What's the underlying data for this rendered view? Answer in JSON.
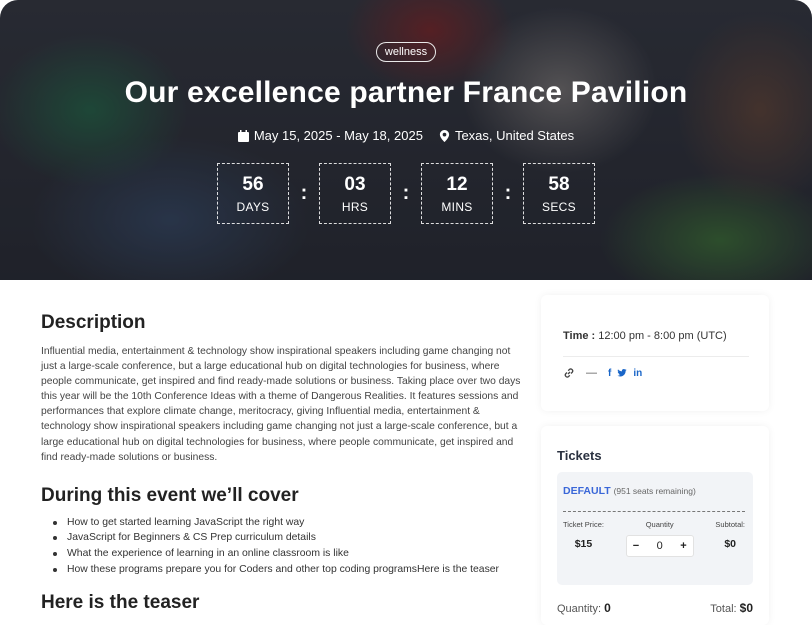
{
  "hero": {
    "tag": "wellness",
    "title": "Our excellence partner France Pavilion",
    "date_range": "May 15, 2025 - May 18, 2025",
    "location": "Texas, United States",
    "countdown": [
      {
        "value": "56",
        "label": "DAYS"
      },
      {
        "value": "03",
        "label": "HRS"
      },
      {
        "value": "12",
        "label": "MINS"
      },
      {
        "value": "58",
        "label": "SECS"
      }
    ],
    "separator": ":"
  },
  "description": {
    "heading": "Description",
    "text": "Influential media, entertainment & technology show inspirational speakers including game changing not just a large-scale conference, but a large educational hub on digital technologies for business, where people communicate, get inspired and find ready-made solutions or business. Taking place over two days this year will be the 10th Conference Ideas with a theme of Dangerous Realities. It features sessions and performances that explore climate change, meritocracy, giving Influential media, entertainment & technology show inspirational speakers including game changing not just a large-scale conference, but a large educational hub on digital technologies for business, where people communicate, get inspired and find ready-made solutions or business."
  },
  "cover": {
    "heading": "During this event we’ll cover",
    "items": [
      "How to get started learning JavaScript the right way",
      "JavaScript for Beginners & CS Prep curriculum details",
      "What the experience of learning in an online classroom is like",
      "How these programs prepare you for Coders and other top coding programsHere is the teaser"
    ]
  },
  "teaser": {
    "heading": "Here is the teaser"
  },
  "time_card": {
    "time_label": "Time :",
    "time_value": "12:00 pm - 8:00 pm (UTC)",
    "dash": "—",
    "social": {
      "facebook": "f",
      "linkedin": "in"
    }
  },
  "tickets": {
    "heading": "Tickets",
    "ticket_name": "DEFAULT",
    "seats_remaining": "(951 seats remaining)",
    "price_label": "Ticket Price:",
    "price": "$15",
    "quantity_label": "Quantity",
    "quantity_minus": "−",
    "quantity_value": "0",
    "quantity_plus": "+",
    "subtotal_label": "Subtotal:",
    "subtotal": "$0",
    "footer_quantity_label": "Quantity:",
    "footer_quantity": "0",
    "footer_total_label": "Total:",
    "footer_total": "$0"
  },
  "colors": {
    "accent": "#3a67d8",
    "social": "#1a66c8"
  }
}
